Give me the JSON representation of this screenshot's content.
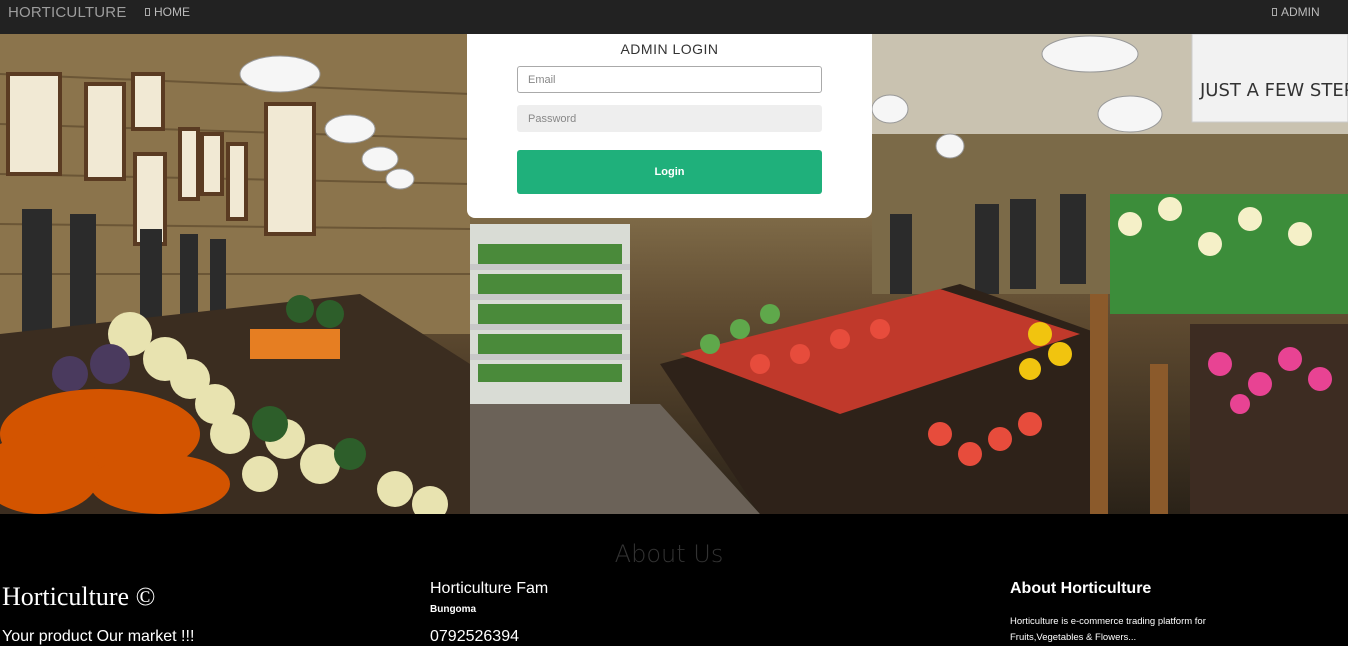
{
  "navbar": {
    "brand": "HORTICULTURE",
    "home_label": "HOME",
    "admin_label": "ADMIN"
  },
  "hero": {
    "background_scene": "grocery-store-produce-photo",
    "sign_text": "JUST A FEW STEPS"
  },
  "login": {
    "title": "ADMIN LOGIN",
    "email_placeholder": "Email",
    "email_value": "",
    "password_placeholder": "Password",
    "password_value": "",
    "button_label": "Login",
    "button_color": "#1fb07b"
  },
  "about": {
    "title": "About Us",
    "col1": {
      "title": "Horticulture ©",
      "tagline": "Your product Our market !!!"
    },
    "col2": {
      "title": "Horticulture Fam",
      "location": "Bungoma",
      "phone": "0792526394"
    },
    "col3": {
      "title": "About Horticulture",
      "description": "Horticulture is e-commerce trading platform for Fruits,Vegetables & Flowers..."
    }
  }
}
